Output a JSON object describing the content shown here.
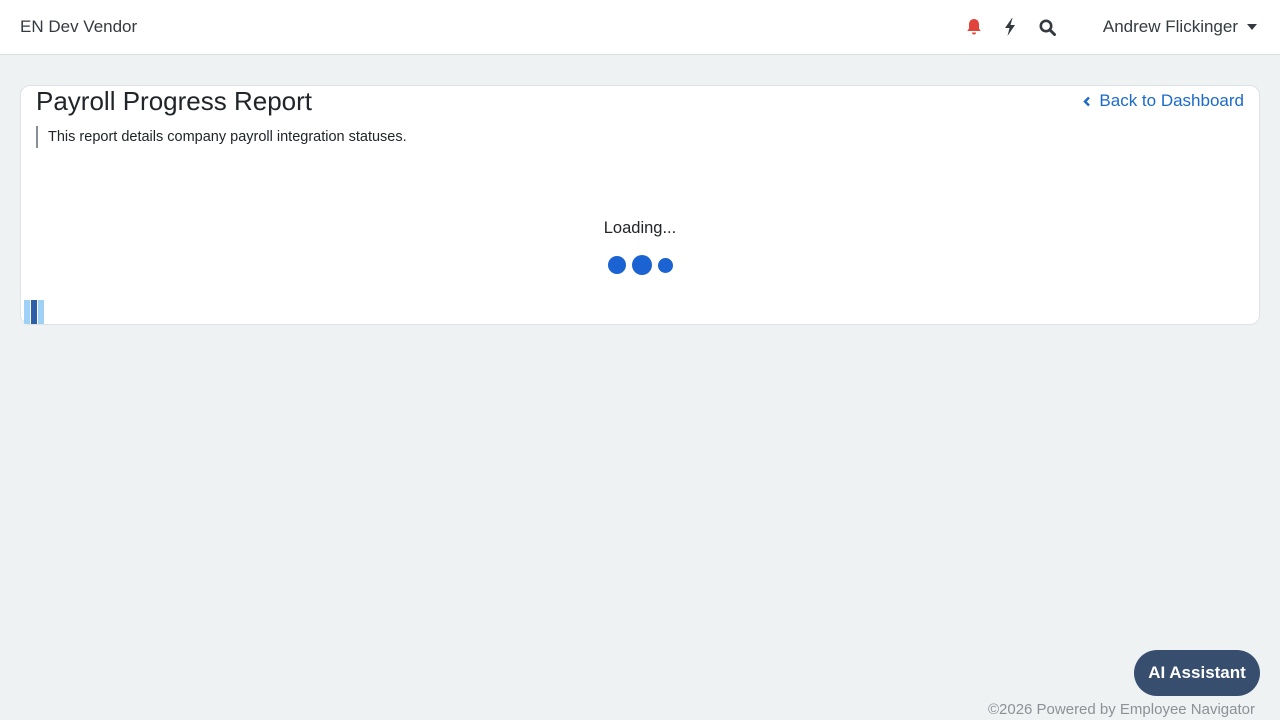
{
  "header": {
    "brand": "EN Dev Vendor",
    "icons": {
      "notifications": "bell-icon",
      "quick_actions": "bolt-icon",
      "search": "search-icon"
    },
    "user_name": "Andrew Flickinger"
  },
  "report": {
    "title": "Payroll Progress Report",
    "back_link": "Back to Dashboard",
    "description": "This report details company payroll integration statuses.",
    "loading_text": "Loading..."
  },
  "ai_assistant": {
    "label": "AI Assistant"
  },
  "footer": {
    "text": "©2026 Powered by Employee Navigator"
  },
  "colors": {
    "background": "#eff2f3",
    "accent": "#1b6ac9",
    "bell": "#e0443a",
    "spinner": "#1b62d2",
    "ai_button": "#374e6e"
  }
}
